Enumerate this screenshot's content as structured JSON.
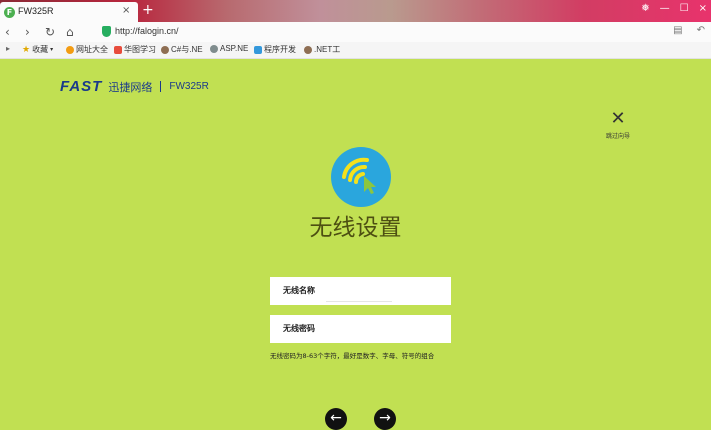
{
  "browser": {
    "tab_title": "FW325R",
    "tab_favicon": "F",
    "tab_close": "×",
    "new_tab": "+",
    "url": "http://falogin.cn/",
    "window_controls": [
      "❅",
      "—",
      "☐",
      "×"
    ],
    "bookmarks": [
      {
        "label": "收藏",
        "color": "#f1c40f"
      },
      {
        "label": "网址大全",
        "color": "#f39c12"
      },
      {
        "label": "华图学习",
        "color": "#e74c3c"
      },
      {
        "label": "C#与.NE",
        "color": "#8e6e53"
      },
      {
        "label": "ASP.NE",
        "color": "#7f8c8d"
      },
      {
        "label": "程序开发",
        "color": "#3498db"
      },
      {
        "label": ".NET工",
        "color": "#8e6e53"
      }
    ]
  },
  "brand": {
    "logo": "FAST",
    "name_cn": "迅捷网络",
    "model": "FW325R"
  },
  "skip": {
    "icon": "close-icon",
    "label": "跳过向导"
  },
  "page": {
    "title": "无线设置",
    "ssid_label": "无线名称",
    "ssid_value": "",
    "password_label": "无线密码",
    "password_value": "",
    "hint": "无线密码为8-63个字符，最好是数字、字母、符号的组合"
  },
  "colors": {
    "background": "#c1e052",
    "badge": "#2aa6dd",
    "brand": "#1a3a8a"
  }
}
